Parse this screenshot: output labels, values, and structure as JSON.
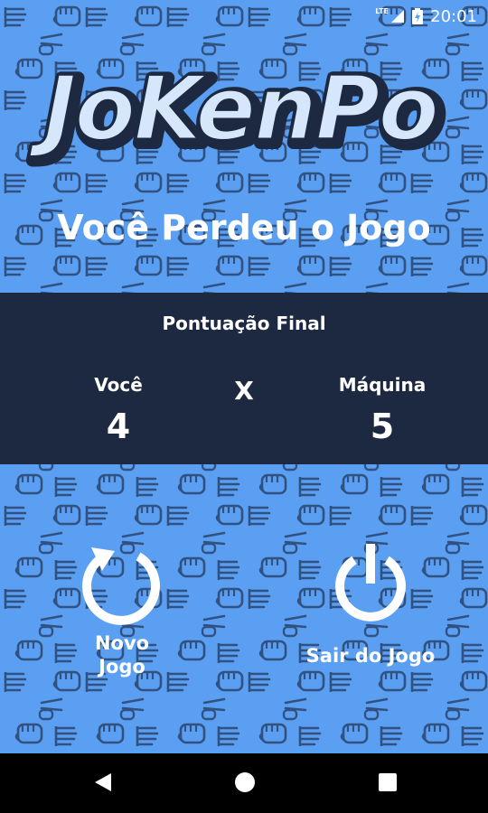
{
  "status_bar": {
    "time": "20:01",
    "network": "LTE"
  },
  "app": {
    "title": "JoKenPo",
    "result_text": "Você Perdeu o Jogo"
  },
  "score": {
    "title": "Pontuação Final",
    "player_label": "Você",
    "player_score": "4",
    "versus": "X",
    "machine_label": "Máquina",
    "machine_score": "5"
  },
  "actions": {
    "new_game_line1": "Novo",
    "new_game_line2": "Jogo",
    "exit_game": "Sair do Jogo"
  },
  "colors": {
    "background": "#5b9ff3",
    "panel": "#1d2940",
    "text": "#ffffff"
  },
  "icons": [
    "restart-icon",
    "power-icon",
    "back-icon",
    "home-icon",
    "recents-icon",
    "battery-icon",
    "signal-icon"
  ]
}
